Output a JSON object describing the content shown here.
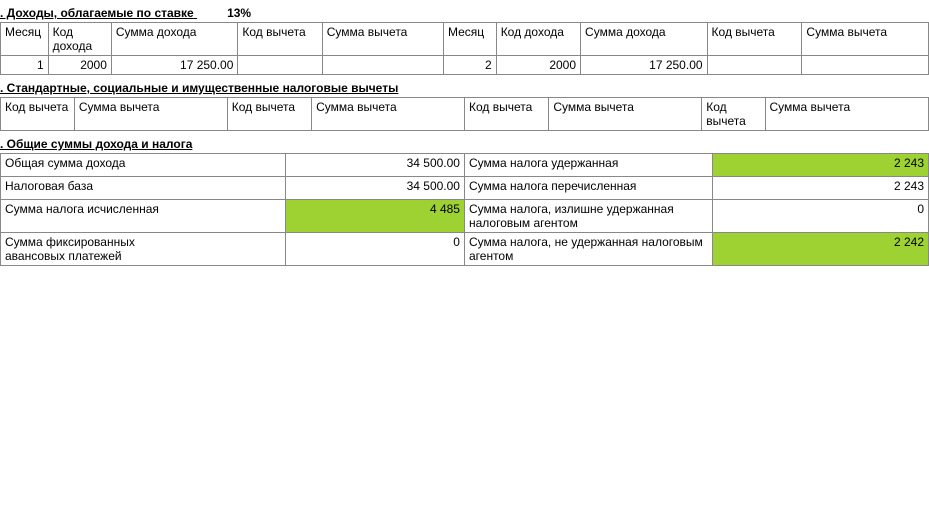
{
  "section3": {
    "title": ". Доходы, облагаемые по ставке",
    "rate": "13%",
    "headers": {
      "month": "Месяц",
      "incomeCode": "Код дохода",
      "incomeSum": "Сумма дохода",
      "deductCode": "Код вычета",
      "deductSum": "Сумма вычета"
    },
    "rows": [
      {
        "month": "1",
        "incomeCode": "2000",
        "incomeSum": "17 250.00",
        "deductCode": "",
        "deductSum": "",
        "month2": "2",
        "incomeCode2": "2000",
        "incomeSum2": "17 250.00",
        "deductCode2": "",
        "deductSum2": ""
      }
    ]
  },
  "section4": {
    "title": ". Стандартные, социальные и имущественные налоговые вычеты",
    "headers": {
      "code": "Код вычета",
      "sum": "Сумма вычета",
      "codeWrap": "Код вычета"
    }
  },
  "section5": {
    "title": ". Общие суммы дохода и налога",
    "rows": {
      "totalIncomeLabel": "Общая сумма дохода",
      "totalIncome": "34 500.00",
      "taxWithheldLabel": "Сумма налога удержанная",
      "taxWithheld": "2 243",
      "taxBaseLabel": "Налоговая база",
      "taxBase": "34 500.00",
      "taxTransferredLabel": "Сумма налога перечисленная",
      "taxTransferred": "2 243",
      "taxCalcLabel": "Сумма налога исчисленная",
      "taxCalc": "4 485",
      "taxExcessLabel": "Сумма налога, излишне удержанная налоговым агентом",
      "taxExcess": "0",
      "fixedAdvanceLabel": "Сумма фиксированных\nавансовых платежей",
      "fixedAdvance": "0",
      "taxNotWithheldLabel": "Сумма налога, не удержанная налоговым агентом",
      "taxNotWithheld": "2 242"
    }
  }
}
